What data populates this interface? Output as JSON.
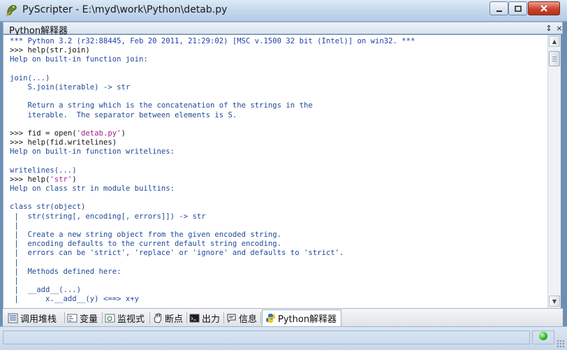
{
  "window": {
    "title": "PyScripter - E:\\myd\\work\\Python\\detab.py"
  },
  "panel": {
    "title": "Python解释器",
    "pin_glyph": "↕",
    "close_glyph": "×"
  },
  "console": {
    "lines": [
      {
        "t": "*** Python 3.2 (r32:88445, Feb 20 2011, 21:29:02) [MSC v.1500 32 bit (Intel)] on win32. ***",
        "k": "banner"
      },
      {
        "t": ">>> help(str.join)",
        "k": "prompt"
      },
      {
        "t": "Help on built-in function join:",
        "k": "out"
      },
      {
        "t": "",
        "k": "out"
      },
      {
        "t": "join(...)",
        "k": "out"
      },
      {
        "t": "    S.join(iterable) -> str",
        "k": "out"
      },
      {
        "t": "",
        "k": "out"
      },
      {
        "t": "    Return a string which is the concatenation of the strings in the",
        "k": "out"
      },
      {
        "t": "    iterable.  The separator between elements is S.",
        "k": "out"
      },
      {
        "t": "",
        "k": "out"
      },
      {
        "t": ">>> fid = open('detab.py')",
        "k": "prompt"
      },
      {
        "t": ">>> help(fid.writelines)",
        "k": "prompt"
      },
      {
        "t": "Help on built-in function writelines:",
        "k": "out"
      },
      {
        "t": "",
        "k": "out"
      },
      {
        "t": "writelines(...)",
        "k": "out"
      },
      {
        "t": ">>> help('str')",
        "k": "prompt"
      },
      {
        "t": "Help on class str in module builtins:",
        "k": "out"
      },
      {
        "t": "",
        "k": "out"
      },
      {
        "t": "class str(object)",
        "k": "out"
      },
      {
        "t": " |  str(string[, encoding[, errors]]) -> str",
        "k": "out"
      },
      {
        "t": " |",
        "k": "out"
      },
      {
        "t": " |  Create a new string object from the given encoded string.",
        "k": "out"
      },
      {
        "t": " |  encoding defaults to the current default string encoding.",
        "k": "out"
      },
      {
        "t": " |  errors can be 'strict', 'replace' or 'ignore' and defaults to 'strict'.",
        "k": "out"
      },
      {
        "t": " |",
        "k": "out"
      },
      {
        "t": " |  Methods defined here:",
        "k": "out"
      },
      {
        "t": " |",
        "k": "out"
      },
      {
        "t": " |  __add__(...)",
        "k": "out"
      },
      {
        "t": " |      x.__add__(y) <==> x+y",
        "k": "out"
      }
    ]
  },
  "tabs": [
    {
      "label": "调用堆栈",
      "icon": "call-stack-icon",
      "active": false
    },
    {
      "label": "变量",
      "icon": "variables-icon",
      "active": false
    },
    {
      "label": "监视式",
      "icon": "watches-icon",
      "active": false
    },
    {
      "label": "断点",
      "icon": "breakpoints-icon",
      "active": false
    },
    {
      "label": "出力",
      "icon": "output-icon",
      "active": false
    },
    {
      "label": "信息",
      "icon": "messages-icon",
      "active": false
    },
    {
      "label": "Python解释器",
      "icon": "python-icon",
      "active": true
    }
  ],
  "status": {
    "indicator_color": "#2dbb1c"
  }
}
